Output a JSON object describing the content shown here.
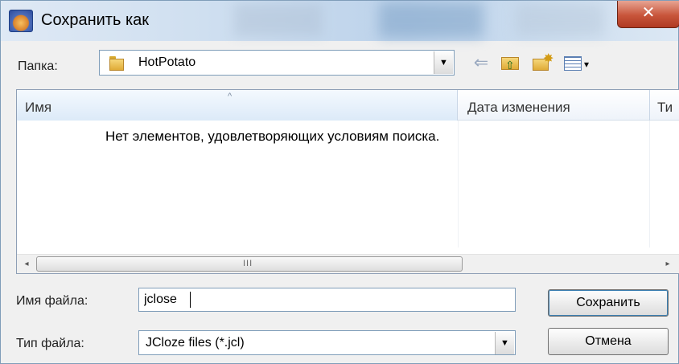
{
  "window": {
    "title": "Сохранить как",
    "close_glyph": "✕"
  },
  "toolbar": {
    "folder_label": "Папка:",
    "folder_value": "HotPotato",
    "dropdown_glyph": "▼",
    "back_glyph": "⇐",
    "view_glyph": "▾"
  },
  "file_list": {
    "columns": {
      "name": "Имя",
      "date": "Дата изменения",
      "type": "Ти"
    },
    "sort_glyph": "^",
    "empty_message": "Нет элементов, удовлетворяющих условиям поиска.",
    "scroll_left_glyph": "◂",
    "scroll_right_glyph": "▸",
    "scroll_grip": "III"
  },
  "fields": {
    "filename_label": "Имя файла:",
    "filename_value": "jclose",
    "filetype_label": "Тип файла:",
    "filetype_value": "JCloze files (*.jcl)"
  },
  "buttons": {
    "save": "Сохранить",
    "cancel": "Отмена"
  }
}
